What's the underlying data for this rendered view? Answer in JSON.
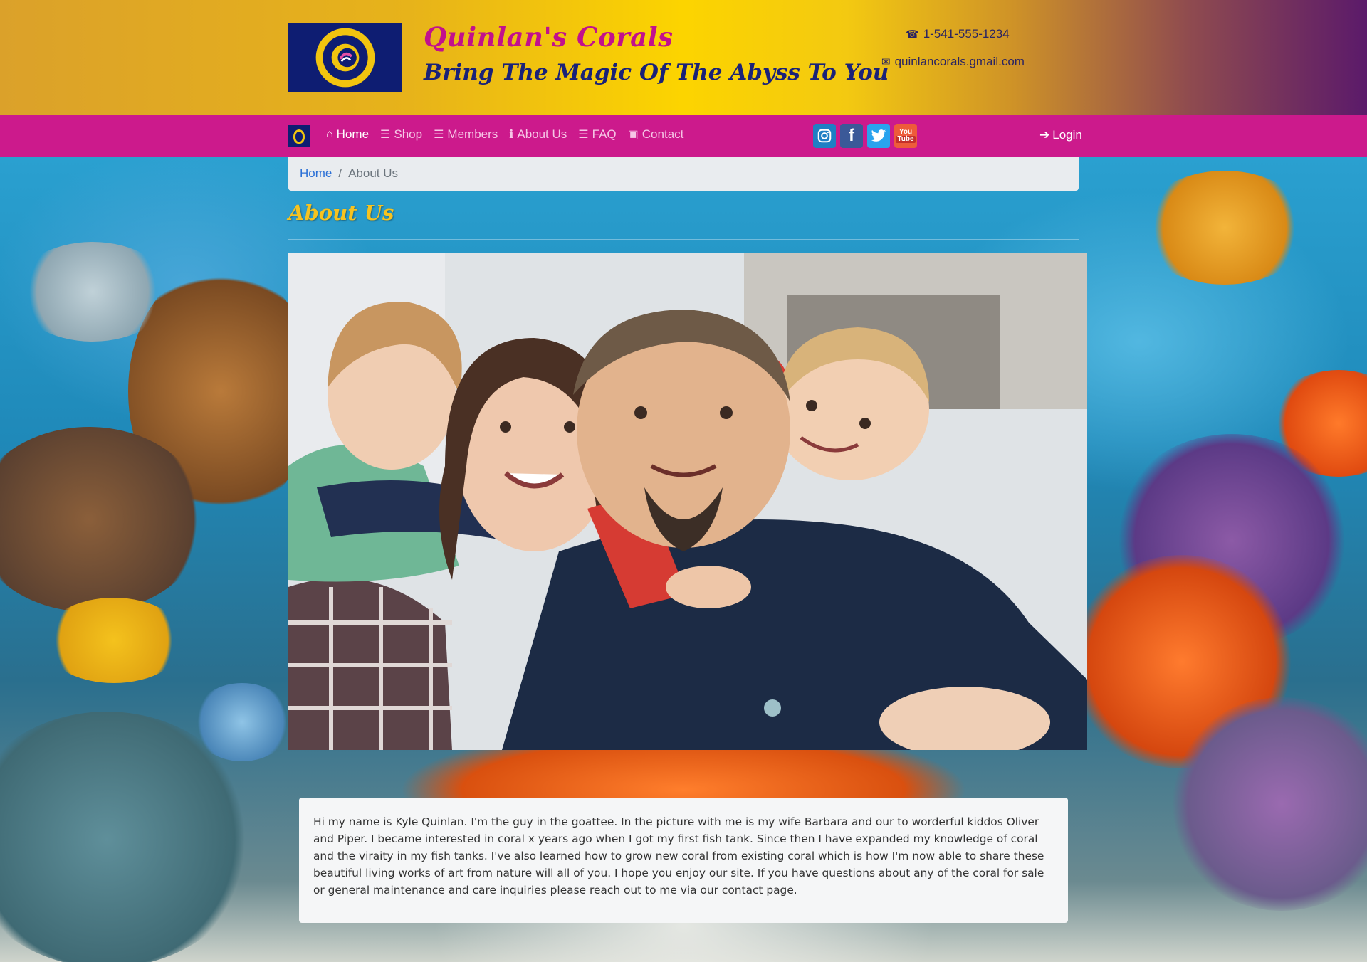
{
  "header": {
    "logo_text": "QUINLAN'S CORALS",
    "title": "Quinlan's Corals",
    "tagline": "Bring The Magic Of The Abyss To You",
    "phone": "1-541-555-1234",
    "email": "quinlancorals.gmail.com"
  },
  "nav": {
    "items": [
      {
        "label": "Home",
        "icon": "home-icon"
      },
      {
        "label": "Shop",
        "icon": "list-icon"
      },
      {
        "label": "Members",
        "icon": "list-icon"
      },
      {
        "label": "About Us",
        "icon": "info-icon"
      },
      {
        "label": "FAQ",
        "icon": "list-icon"
      },
      {
        "label": "Contact",
        "icon": "id-card-icon"
      }
    ],
    "social": {
      "instagram": "instagram-icon",
      "facebook": "f",
      "twitter": "twitter-icon",
      "youtube_top": "You",
      "youtube_bottom": "Tube"
    },
    "login": "Login"
  },
  "breadcrumb": {
    "home": "Home",
    "separator": "/",
    "current": "About Us"
  },
  "page": {
    "heading": "About Us",
    "bio": "Hi my name is Kyle Quinlan. I'm the guy in the goattee. In the picture with me is my wife Barbara and our to worderful kiddos Oliver and Piper. I became interested in coral x years ago when I got my first fish tank. Since then I have expanded my knowledge of coral and the viraity in my fish tanks. I've also learned how to grow new coral from existing coral which is how I'm now able to share these beautiful living works of art from nature will all of you. I hope you enjoy our site. If you have questions about any of the coral for sale or general maintenance and care inquiries please reach out to me via our contact page."
  },
  "colors": {
    "brand_pink": "#cc1a8c",
    "brand_navy": "#0e1d72",
    "heading_gold": "#f7c31f",
    "link_blue": "#2a6fd6"
  }
}
